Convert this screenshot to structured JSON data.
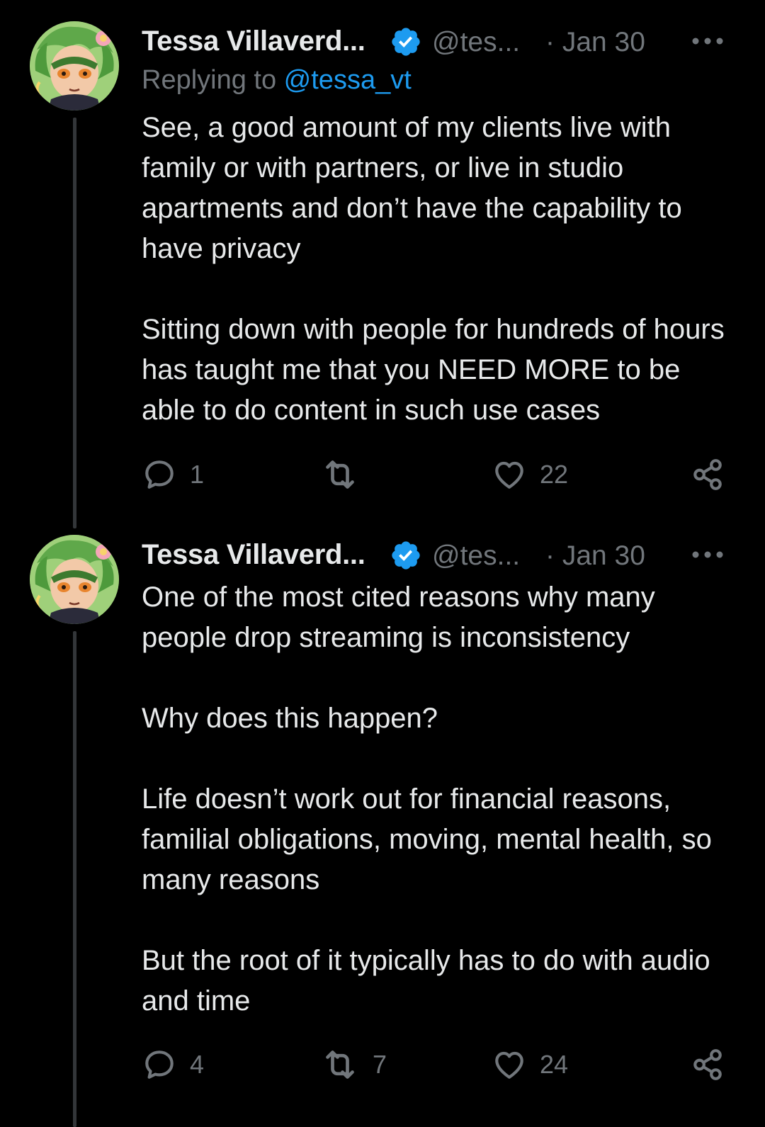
{
  "colors": {
    "background": "#000000",
    "text_primary": "#e7e9ea",
    "text_secondary": "#71767b",
    "link": "#1d9bf0",
    "thread_line": "#333639",
    "verified": "#1d9bf0"
  },
  "tweets": [
    {
      "author": {
        "display_name": "Tessa Villaverd...",
        "handle": "@tes...",
        "verified_icon": "verified-badge-icon",
        "avatar_icon": "avatar"
      },
      "date": "· Jan 30",
      "replying_to": {
        "prefix": "Replying to ",
        "mention": "@tessa_vt"
      },
      "paragraphs": [
        "See, a good amount of my clients live with family or with partners, or live in studio apartments and don’t have the capability to have privacy",
        "Sitting down with people for hundreds of hours has taught me that you NEED MORE to be able to do content in such use cases"
      ],
      "actions": {
        "reply": {
          "icon": "reply-icon",
          "count": "1"
        },
        "retweet": {
          "icon": "retweet-icon",
          "count": ""
        },
        "like": {
          "icon": "heart-icon",
          "count": "22"
        },
        "share": {
          "icon": "share-icon"
        }
      }
    },
    {
      "author": {
        "display_name": "Tessa Villaverd...",
        "handle": "@tes...",
        "verified_icon": "verified-badge-icon",
        "avatar_icon": "avatar"
      },
      "date": "· Jan 30",
      "paragraphs": [
        "One of the most cited reasons why many people drop streaming is inconsistency",
        "Why does this happen?",
        "Life doesn’t work out for financial reasons, familial obligations, moving, mental health, so many reasons",
        "But the root of it typically has to do with audio and time"
      ],
      "actions": {
        "reply": {
          "icon": "reply-icon",
          "count": "4"
        },
        "retweet": {
          "icon": "retweet-icon",
          "count": "7"
        },
        "like": {
          "icon": "heart-icon",
          "count": "24"
        },
        "share": {
          "icon": "share-icon"
        }
      }
    }
  ]
}
